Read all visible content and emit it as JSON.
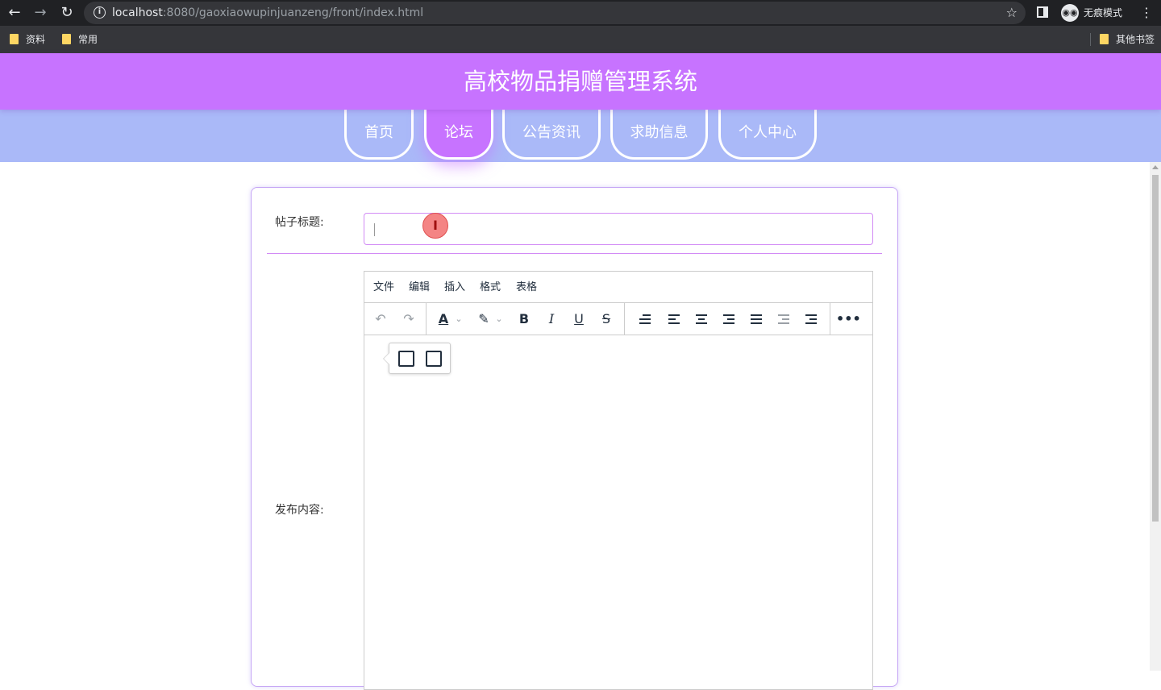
{
  "browser": {
    "url_host": "localhost",
    "url_rest": ":8080/gaoxiaowupinjuanzeng/front/index.html",
    "incognito_label": "无痕模式",
    "icons": [
      "back-arrow-icon",
      "forward-arrow-icon",
      "reload-icon",
      "info-icon",
      "star-icon",
      "side-panel-icon",
      "incognito-icon",
      "more-icon"
    ],
    "bookmarks": [
      {
        "label": "资料"
      },
      {
        "label": "常用"
      }
    ],
    "other_bookmarks": "其他书签"
  },
  "site": {
    "title": "高校物品捐赠管理系统",
    "accent_color": "#c773ff",
    "nav_color": "#aab9f8",
    "nav": [
      {
        "label": "首页",
        "active": false
      },
      {
        "label": "论坛",
        "active": true
      },
      {
        "label": "公告资讯",
        "active": false
      },
      {
        "label": "求助信息",
        "active": false
      },
      {
        "label": "个人中心",
        "active": false
      }
    ]
  },
  "form": {
    "title_label": "帖子标题:",
    "title_value": "",
    "content_label": "发布内容:"
  },
  "editor": {
    "menus": [
      "文件",
      "编辑",
      "插入",
      "格式",
      "表格"
    ],
    "toolbar": [
      "undo-icon",
      "redo-icon",
      "text-color-icon",
      "highlight-color-icon",
      "bold-icon",
      "italic-icon",
      "underline-icon",
      "strikethrough-icon",
      "line-height-icon",
      "align-left-icon",
      "align-center-icon",
      "align-right-icon",
      "justify-icon",
      "outdent-icon",
      "indent-icon",
      "more-icon"
    ],
    "quick_insert": [
      "image-icon",
      "table-icon"
    ]
  }
}
